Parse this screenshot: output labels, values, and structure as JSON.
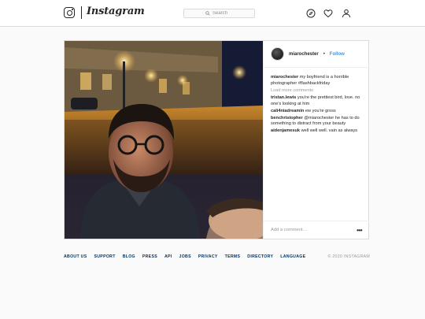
{
  "header": {
    "wordmark": "Instagram",
    "search_placeholder": "Search",
    "icons": [
      "instagram-camera-icon",
      "search-icon",
      "explore-compass-icon",
      "activity-heart-icon",
      "profile-person-icon"
    ]
  },
  "post": {
    "username": "miarochester",
    "separator": "•",
    "follow_label": "Follow",
    "caption": {
      "user": "miarochester",
      "text": "my boyfriend is a horrible photographer #flashbackfriday"
    },
    "load_more": "Load more comments",
    "comments": [
      {
        "user": "tristan.lewis",
        "text": "you're the prettiest bird, love. no one's looking at him"
      },
      {
        "user": "cali4niadreamin",
        "text": "ew you're gross"
      },
      {
        "user": "benchristopher",
        "text": "@miarochester he has to do something to distract from your beauty"
      },
      {
        "user": "aidenjamesuk",
        "text": "well well well. vain as always"
      }
    ],
    "add_comment_placeholder": "Add a comment…",
    "more_options": "•••"
  },
  "footer": {
    "links": [
      "ABOUT US",
      "SUPPORT",
      "BLOG",
      "PRESS",
      "API",
      "JOBS",
      "PRIVACY",
      "TERMS",
      "DIRECTORY",
      "LANGUAGE"
    ],
    "copyright": "© 2020 INSTAGRAM"
  },
  "colors": {
    "link_blue": "#3897f0",
    "footer_link": "#003569",
    "border": "#dbdbdb",
    "background": "#fafafa"
  }
}
